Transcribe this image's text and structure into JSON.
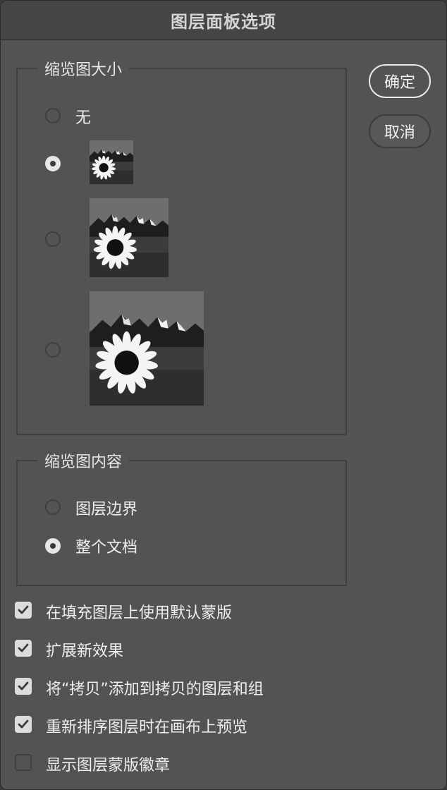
{
  "dialog": {
    "title": "图层面板选项"
  },
  "buttons": {
    "ok_label": "确定",
    "cancel_label": "取消"
  },
  "thumbnail_size": {
    "legend": "缩览图大小",
    "options": [
      {
        "label": "无",
        "checked": false
      },
      {
        "label": "",
        "checked": true,
        "thumb": "small-sunflower-thumbnail"
      },
      {
        "label": "",
        "checked": false,
        "thumb": "medium-sunflower-thumbnail"
      },
      {
        "label": "",
        "checked": false,
        "thumb": "large-sunflower-thumbnail"
      }
    ]
  },
  "thumbnail_content": {
    "legend": "缩览图内容",
    "options": [
      {
        "label": "图层边界",
        "checked": false
      },
      {
        "label": "整个文档",
        "checked": true
      }
    ]
  },
  "checkboxes": [
    {
      "label": "在填充图层上使用默认蒙版",
      "checked": true
    },
    {
      "label": "扩展新效果",
      "checked": true
    },
    {
      "label": "将“拷贝”添加到拷贝的图层和组",
      "checked": true
    },
    {
      "label": "重新排序图层时在画布上预览",
      "checked": true
    },
    {
      "label": "显示图层蒙版徽章",
      "checked": false
    }
  ],
  "icons": {
    "checkmark": "checkmark-icon"
  },
  "colors": {
    "dialog_bg": "#535353",
    "titlebar_bg": "#454545",
    "text": "#eeeeee",
    "accent": "#e6e6e6"
  }
}
